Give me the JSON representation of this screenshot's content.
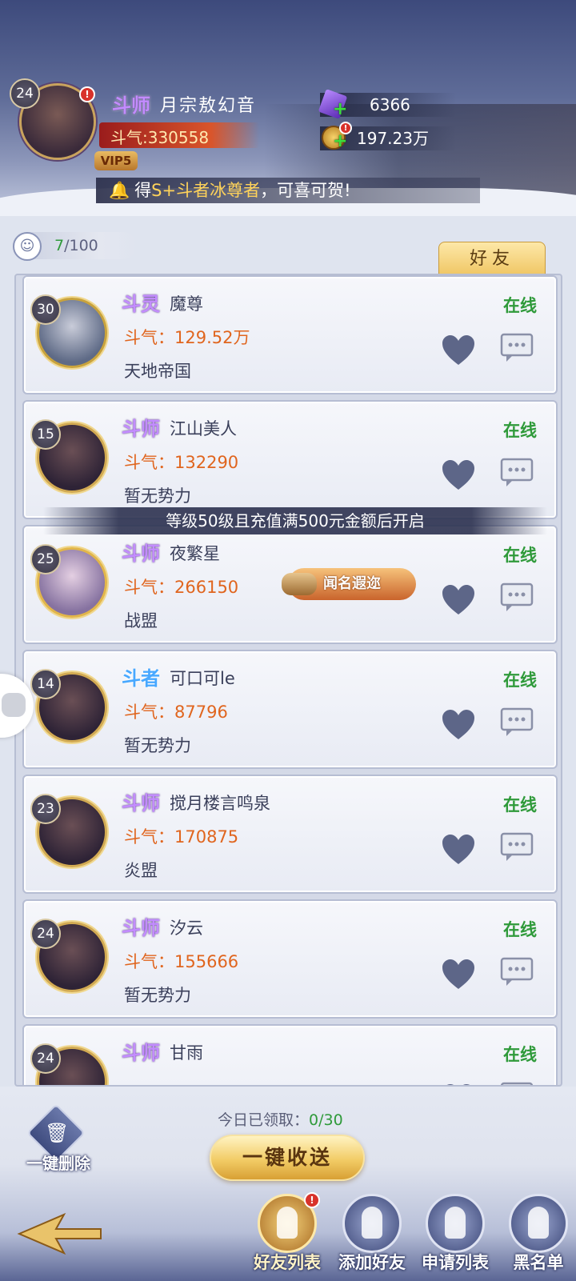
{
  "player": {
    "level": "24",
    "rank": "斗师",
    "name": "月宗敖幻音",
    "power": "斗气:330558",
    "vip": "VIP5",
    "alert": "!"
  },
  "currency": {
    "gems": "6366",
    "gold": "197.23万",
    "plus": "+"
  },
  "marquee": {
    "prefix": "得",
    "highlight": "S+斗者冰尊者",
    "suffix": "，可喜可贺!"
  },
  "friend_count": {
    "current": "7",
    "max": "/100"
  },
  "tab": {
    "label": "好友"
  },
  "unlock_notice": "等级50级且充值满500元金额后开启",
  "friends": [
    {
      "level": "30",
      "rank": "斗灵",
      "rank_color": "purple",
      "name": "魔尊",
      "power": "斗气：129.52万",
      "guild": "天地帝国",
      "status": "在线"
    },
    {
      "level": "15",
      "rank": "斗师",
      "rank_color": "purple",
      "name": "江山美人",
      "power": "斗气：132290",
      "guild": "暂无势力",
      "status": "在线"
    },
    {
      "level": "25",
      "rank": "斗师",
      "rank_color": "purple",
      "name": "夜繁星",
      "power": "斗气：266150",
      "guild": "战盟",
      "status": "在线",
      "badge": "闻名遐迩"
    },
    {
      "level": "14",
      "rank": "斗者",
      "rank_color": "blue",
      "name": "可口可le",
      "power": "斗气：87796",
      "guild": "暂无势力",
      "status": "在线"
    },
    {
      "level": "23",
      "rank": "斗师",
      "rank_color": "purple",
      "name": "搅月楼言鸣泉",
      "power": "斗气：170875",
      "guild": "炎盟",
      "status": "在线"
    },
    {
      "level": "24",
      "rank": "斗师",
      "rank_color": "purple",
      "name": "汐云",
      "power": "斗气：155666",
      "guild": "暂无势力",
      "status": "在线"
    },
    {
      "level": "24",
      "rank": "斗师",
      "rank_color": "purple",
      "name": "甘雨",
      "power": "",
      "guild": "",
      "status": "在线"
    }
  ],
  "claim": {
    "label": "今日已领取：",
    "value": "0/30"
  },
  "buttons": {
    "oneclick_send": "一键收送",
    "delete_all": "一键删除"
  },
  "bottom_nav": [
    {
      "label": "好友列表",
      "icon": "friends-list-icon",
      "active": true
    },
    {
      "label": "添加好友",
      "icon": "add-friend-icon",
      "active": false
    },
    {
      "label": "申请列表",
      "icon": "request-list-icon",
      "active": false
    },
    {
      "label": "黑名单",
      "icon": "blacklist-icon",
      "active": false
    }
  ],
  "colors": {
    "online": "#2f9a3a",
    "power": "#e0651e",
    "rank_purple": "#c38cff",
    "rank_blue": "#48a8ff",
    "gold_button": "#f2cc66"
  }
}
